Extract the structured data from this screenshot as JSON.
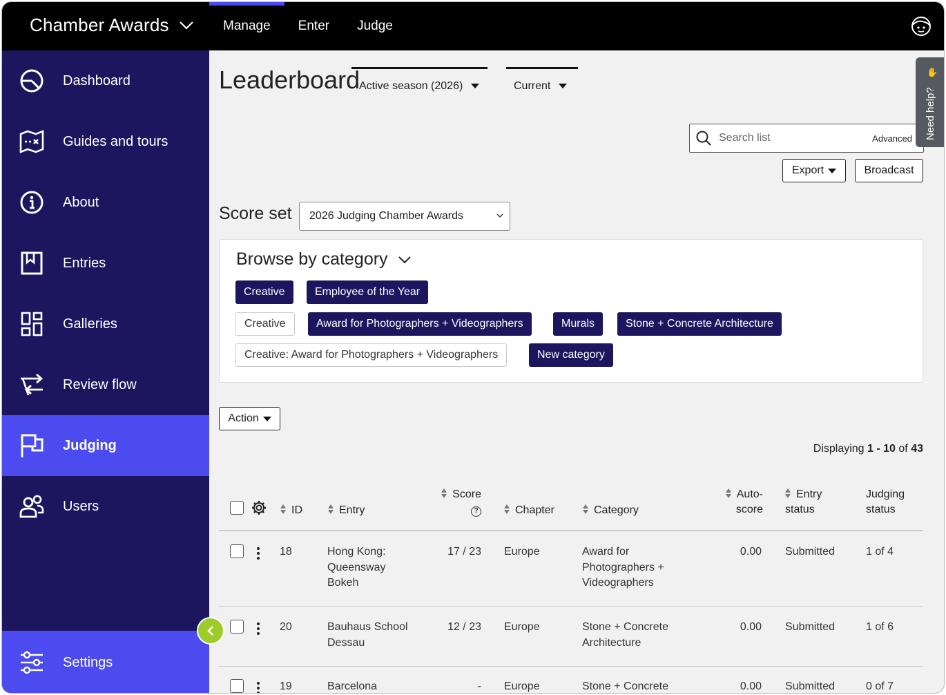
{
  "app": {
    "title": "Chamber Awards"
  },
  "topnav": [
    "Manage",
    "Enter",
    "Judge"
  ],
  "sidebar": {
    "items": [
      {
        "label": "Dashboard",
        "icon": "dashboard-icon"
      },
      {
        "label": "Guides and tours",
        "icon": "map-icon"
      },
      {
        "label": "About",
        "icon": "info-icon"
      },
      {
        "label": "Entries",
        "icon": "bookmark-icon"
      },
      {
        "label": "Galleries",
        "icon": "galleries-icon"
      },
      {
        "label": "Review flow",
        "icon": "review-flow-icon"
      },
      {
        "label": "Judging",
        "icon": "flag-icon",
        "active": true
      },
      {
        "label": "Users",
        "icon": "users-icon"
      }
    ],
    "settings": "Settings"
  },
  "page": {
    "title": "Leaderboard",
    "season_filter": "Active season (2026)",
    "round_filter": "Current",
    "search_placeholder": "Search list",
    "advanced": "Advanced",
    "help": "Need help?",
    "export": "Export",
    "broadcast": "Broadcast",
    "scoreset_label": "Score set",
    "scoreset_value": "2026 Judging Chamber Awards",
    "browse_title": "Browse by category",
    "categories": [
      "Creative",
      "Employee of the Year",
      "Creative",
      "Award for Photographers + Videographers",
      "Murals",
      "Stone + Concrete Architecture",
      "Creative: Award for Photographers + Videographers",
      "New category"
    ],
    "action": "Action",
    "displaying": {
      "prefix": "Displaying",
      "range": "1 - 10",
      "of": "of",
      "total": "43"
    }
  },
  "table": {
    "headers": {
      "id": "ID",
      "entry": "Entry",
      "score": "Score",
      "chapter": "Chapter",
      "category": "Category",
      "autoscore_1": "Auto-",
      "autoscore_2": "score",
      "entry_status_1": "Entry",
      "entry_status_2": "status",
      "judging_status_1": "Judging",
      "judging_status_2": "status"
    },
    "rows": [
      {
        "id": "18",
        "entry": "Hong Kong: Queensway Bokeh",
        "score": "17 / 23",
        "chapter": "Europe",
        "category": "Award for Photographers + Videographers",
        "autoscore": "0.00",
        "entry_status": "Submitted",
        "judging_status": "1 of 4"
      },
      {
        "id": "20",
        "entry": "Bauhaus School Dessau",
        "score": "12 / 23",
        "chapter": "Europe",
        "category": "Stone + Concrete Architecture",
        "autoscore": "0.00",
        "entry_status": "Submitted",
        "judging_status": "1 of 6"
      },
      {
        "id": "19",
        "entry": "Barcelona",
        "score": "-",
        "chapter": "Europe",
        "category": "Stone + Concrete",
        "autoscore": "0.00",
        "entry_status": "Submitted",
        "judging_status": "0 of 7"
      }
    ]
  },
  "colors": {
    "sidebar": "#1c165f",
    "accent": "#4b4bf0",
    "topbar": "#000000",
    "chip": "#1c165f",
    "collapse": "#9ccc2c"
  }
}
